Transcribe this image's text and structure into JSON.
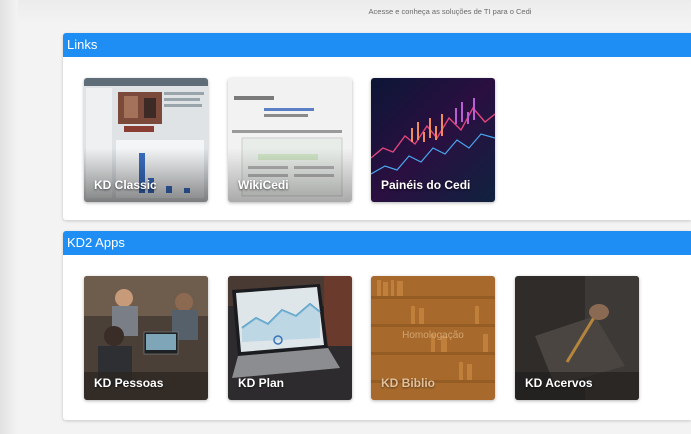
{
  "subtitle": "Acesse e conheça as soluções de TI para o Cedi",
  "sections": [
    {
      "title": "Links",
      "cards": [
        {
          "label": "KD Classic"
        },
        {
          "label": "WikiCedi"
        },
        {
          "label": "Painéis do Cedi"
        }
      ]
    },
    {
      "title": "KD2 Apps",
      "cards": [
        {
          "label": "KD Pessoas"
        },
        {
          "label": "KD Plan"
        },
        {
          "label": "KD Biblio",
          "badge": "Homologação"
        },
        {
          "label": "KD Acervos"
        }
      ]
    }
  ],
  "colors": {
    "header": "#1e8ef5",
    "card_label": "#ffffff"
  }
}
